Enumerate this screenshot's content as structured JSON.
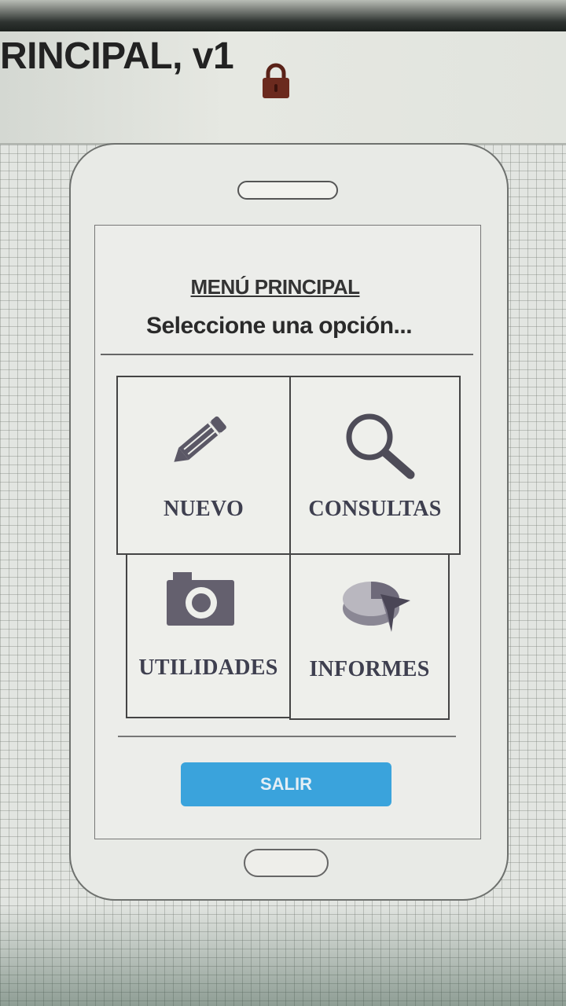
{
  "window": {
    "title": "RINCIPAL, v1"
  },
  "screen": {
    "menu_title": "MENÚ PRINCIPAL",
    "subtitle": "Seleccione una opción..."
  },
  "menu_items": [
    {
      "label": "NUEVO",
      "icon": "pencil-icon"
    },
    {
      "label": "CONSULTAS",
      "icon": "search-icon"
    },
    {
      "label": "UTILIDADES",
      "icon": "camera-icon"
    },
    {
      "label": "INFORMES",
      "icon": "pie-chart-icon"
    }
  ],
  "exit_button": {
    "label": "SALIR"
  },
  "colors": {
    "accent_button": "#3aa3dc",
    "lock_icon": "#6b2a1e",
    "label_text": "#3e3f4f"
  }
}
